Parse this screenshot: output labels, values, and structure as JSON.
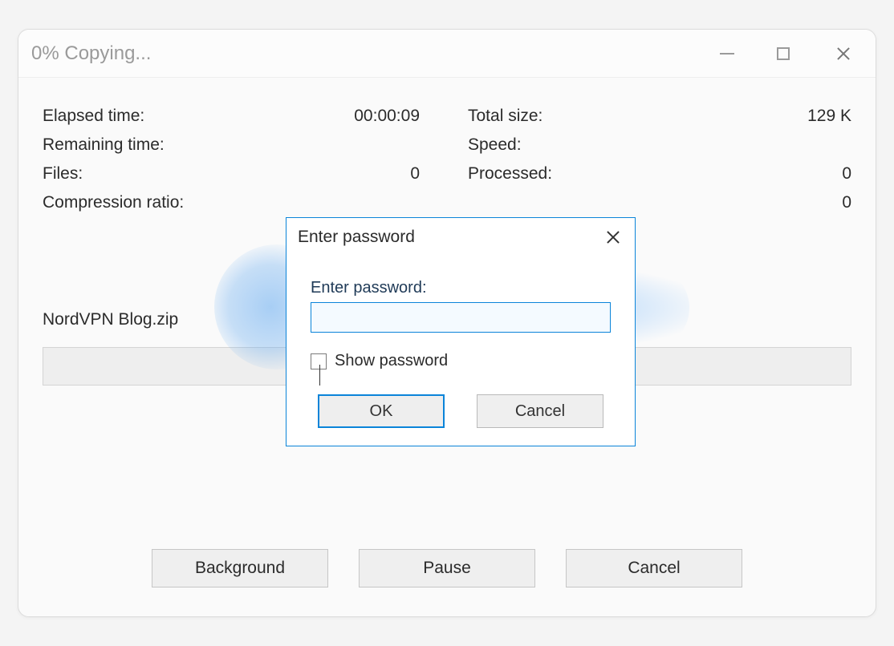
{
  "window": {
    "title": "0% Copying..."
  },
  "stats": {
    "elapsed_label": "Elapsed time:",
    "elapsed_value": "00:00:09",
    "remaining_label": "Remaining time:",
    "remaining_value": "",
    "files_label": "Files:",
    "files_value": "0",
    "compression_label": "Compression ratio:",
    "compression_value": "",
    "total_size_label": "Total size:",
    "total_size_value": "129 K",
    "speed_label": "Speed:",
    "speed_value": "",
    "processed_label": "Processed:",
    "processed_value": "0",
    "row4_right_value": "0"
  },
  "filename": "NordVPN Blog.zip",
  "progress_percent": 0,
  "buttons": {
    "background": "Background",
    "pause": "Pause",
    "cancel": "Cancel"
  },
  "modal": {
    "title": "Enter password",
    "field_label": "Enter password:",
    "password_value": "",
    "show_pw_label": "Show password",
    "ok": "OK",
    "cancel": "Cancel"
  }
}
